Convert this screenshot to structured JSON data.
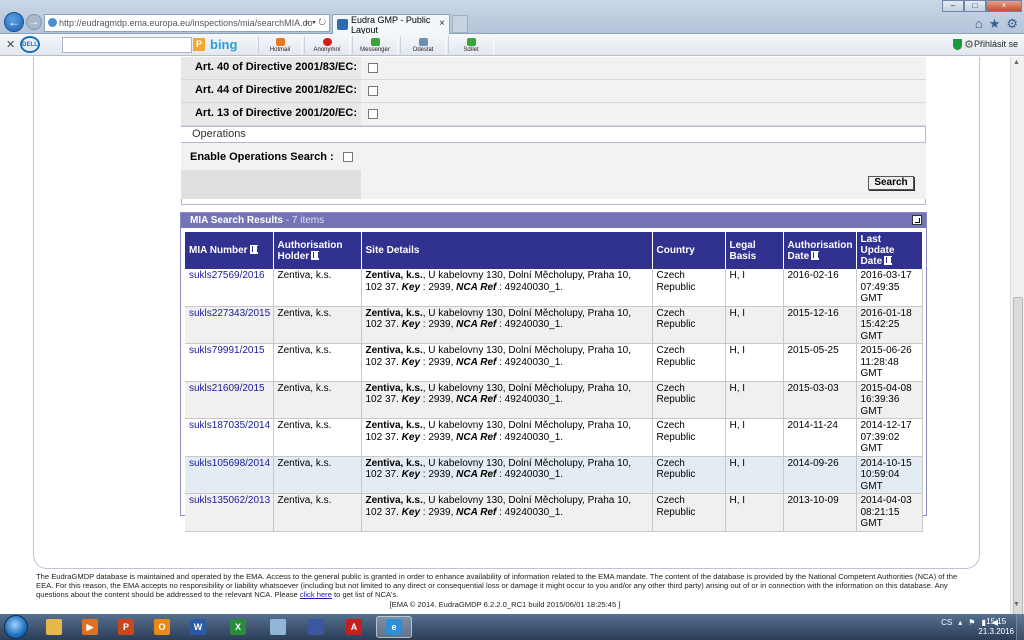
{
  "browser": {
    "url": "http://eudragmdp.ema.europa.eu/inspections/mia/searchMIA.do",
    "tab_title": "Eudra GMP - Public Layout",
    "toolbar_buttons": [
      {
        "label": "Hotmail",
        "color": "#e8781c"
      },
      {
        "label": "Anonymní",
        "color": "#d21c1c"
      },
      {
        "label": "Messenger",
        "color": "#3aa33a"
      },
      {
        "label": "Odeslat",
        "color": "#6f8fb0"
      },
      {
        "label": "Sdílet",
        "color": "#3aa33a"
      }
    ],
    "search_brand": "bing",
    "login_label": "Přihlásit se"
  },
  "criteria": {
    "rows": [
      {
        "label": "Art. 40 of Directive 2001/83/EC:"
      },
      {
        "label": "Art. 44 of Directive 2001/82/EC:"
      },
      {
        "label": "Art. 13 of Directive 2001/20/EC:"
      }
    ],
    "operations_header": "Operations",
    "enable_operations_label": "Enable Operations Search :",
    "search_button": "Search"
  },
  "results": {
    "title": "MIA Search Results",
    "count_text": " - 7 items",
    "columns": [
      "MIA Number",
      "Authorisation Holder",
      "Site Details",
      "Country",
      "Legal Basis",
      "Authorisation Date",
      "Last Update Date"
    ],
    "rows": [
      {
        "mia": "sukls27569/2016",
        "holder": "Zentiva, k.s.",
        "site_name": "Zentiva, k.s.",
        "site_addr": ", U kabelovny 130, Dolní Měcholupy, Praha 10, 102 37. ",
        "key_label": "Key",
        "key": " : 2939, ",
        "nca_label": "NCA Ref",
        "nca": " : 49240030_1.",
        "country": "Czech Republic",
        "basis": "H, I",
        "auth_date": "2016-02-16",
        "update": "2016-03-17 07:49:35 GMT"
      },
      {
        "mia": "sukls227343/2015",
        "holder": "Zentiva, k.s.",
        "site_name": "Zentiva, k.s.",
        "site_addr": ", U kabelovny 130, Dolní Měcholupy, Praha 10, 102 37. ",
        "key_label": "Key",
        "key": " : 2939, ",
        "nca_label": "NCA Ref",
        "nca": " : 49240030_1.",
        "country": "Czech Republic",
        "basis": "H, I",
        "auth_date": "2015-12-16",
        "update": "2016-01-18 15:42:25 GMT"
      },
      {
        "mia": "sukls79991/2015",
        "holder": "Zentiva, k.s.",
        "site_name": "Zentiva, k.s.",
        "site_addr": ", U kabelovny 130, Dolní Měcholupy, Praha 10, 102 37. ",
        "key_label": "Key",
        "key": " : 2939, ",
        "nca_label": "NCA Ref",
        "nca": " : 49240030_1.",
        "country": "Czech Republic",
        "basis": "H, I",
        "auth_date": "2015-05-25",
        "update": "2015-06-26 11:28:48 GMT"
      },
      {
        "mia": "sukls21609/2015",
        "holder": "Zentiva, k.s.",
        "site_name": "Zentiva, k.s.",
        "site_addr": ", U kabelovny 130, Dolní Měcholupy, Praha 10, 102 37. ",
        "key_label": "Key",
        "key": " : 2939, ",
        "nca_label": "NCA Ref",
        "nca": " : 49240030_1.",
        "country": "Czech Republic",
        "basis": "H, I",
        "auth_date": "2015-03-03",
        "update": "2015-04-08 16:39:36 GMT"
      },
      {
        "mia": "sukls187035/2014",
        "holder": "Zentiva, k.s.",
        "site_name": "Zentiva, k.s.",
        "site_addr": ", U kabelovny 130, Dolní Měcholupy, Praha 10, 102 37. ",
        "key_label": "Key",
        "key": " : 2939, ",
        "nca_label": "NCA Ref",
        "nca": " : 49240030_1.",
        "country": "Czech Republic",
        "basis": "H, I",
        "auth_date": "2014-11-24",
        "update": "2014-12-17 07:39:02 GMT"
      },
      {
        "mia": "sukls105698/2014",
        "holder": "Zentiva, k.s.",
        "site_name": "Zentiva, k.s.",
        "site_addr": ", U kabelovny 130, Dolní Měcholupy, Praha 10, 102 37. ",
        "key_label": "Key",
        "key": " : 2939, ",
        "nca_label": "NCA Ref",
        "nca": " : 49240030_1.",
        "country": "Czech Republic",
        "basis": "H, I",
        "auth_date": "2014-09-26",
        "update": "2014-10-15 10:59:04 GMT"
      },
      {
        "mia": "sukls135062/2013",
        "holder": "Zentiva, k.s.",
        "site_name": "Zentiva, k.s.",
        "site_addr": ", U kabelovny 130, Dolní Měcholupy, Praha 10, 102 37. ",
        "key_label": "Key",
        "key": " : 2939, ",
        "nca_label": "NCA Ref",
        "nca": " : 49240030_1.",
        "country": "Czech Republic",
        "basis": "H, I",
        "auth_date": "2013-10-09",
        "update": "2014-04-03 08:21:15 GMT"
      }
    ]
  },
  "footer": {
    "text_before_link": "The EudraGMDP database is maintained and operated by the EMA. Access to the general public is granted in order to enhance availability of information related to the EMA mandate. The content of the database is provided by the National Competent Authorities (NCA) of the EEA. For this reason, the EMA accepts no responsibility or liability whatsoever (including but not limited to any direct or consequential loss or damage it might occur to you and/or any other third party) arising out of or in connection with the information on this database. Any questions about the content should be addressed to the relevant NCA. Please ",
    "link_text": "click here",
    "text_after_link": " to get list of NCA's.",
    "version": "[EMA © 2014. EudraGMDP 6.2.2.0_RC1 build 2015/06/01 18:25:45 ]"
  },
  "taskbar": {
    "apps": [
      {
        "name": "explorer-icon",
        "glyph": "",
        "color": "#e6b84a"
      },
      {
        "name": "media-player-icon",
        "glyph": "▶",
        "color": "#e0701e"
      },
      {
        "name": "powerpoint-icon",
        "glyph": "P",
        "color": "#c8471f"
      },
      {
        "name": "outlook-icon",
        "glyph": "O",
        "color": "#e88b12"
      },
      {
        "name": "word-icon",
        "glyph": "W",
        "color": "#2a5aa6"
      },
      {
        "name": "excel-icon",
        "glyph": "X",
        "color": "#2b8a3c"
      },
      {
        "name": "notepad-icon",
        "glyph": "",
        "color": "#8fb6d8"
      },
      {
        "name": "save-icon",
        "glyph": "",
        "color": "#3a57a0"
      },
      {
        "name": "acrobat-icon",
        "glyph": "A",
        "color": "#c81e1e"
      },
      {
        "name": "internet-explorer-icon",
        "glyph": "e",
        "color": "#2d8fd6"
      }
    ],
    "lang": "CS",
    "time": "15:15",
    "date": "21.3.2016"
  }
}
